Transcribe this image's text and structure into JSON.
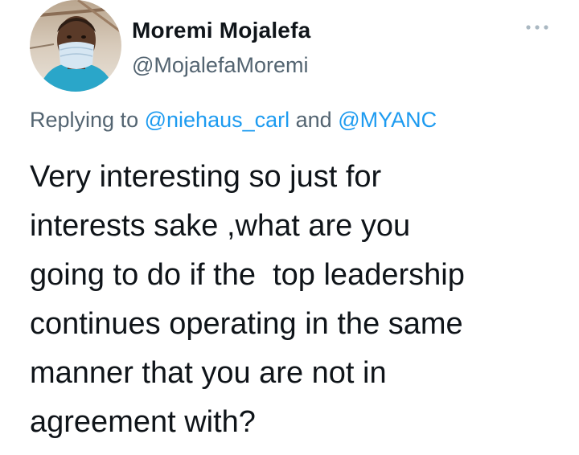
{
  "tweet": {
    "display_name": "Moremi Mojalefa",
    "handle": "@MojalefaMoremi",
    "more_icon": "more-horizontal-icon",
    "replying": {
      "prefix": "Replying to",
      "mention1": "@niehaus_carl",
      "conjunction": "and",
      "mention2": "@MYANC"
    },
    "text_lines": [
      "Very interesting so just for",
      "interests sake ,what are you",
      "going to do if the  top leadership",
      "continues operating in the same",
      "manner that you are not in",
      "agreement with?"
    ]
  },
  "colors": {
    "link": "#1d9bf0",
    "secondary_text": "#536471",
    "primary_text": "#0f1419",
    "background": "#ffffff"
  }
}
